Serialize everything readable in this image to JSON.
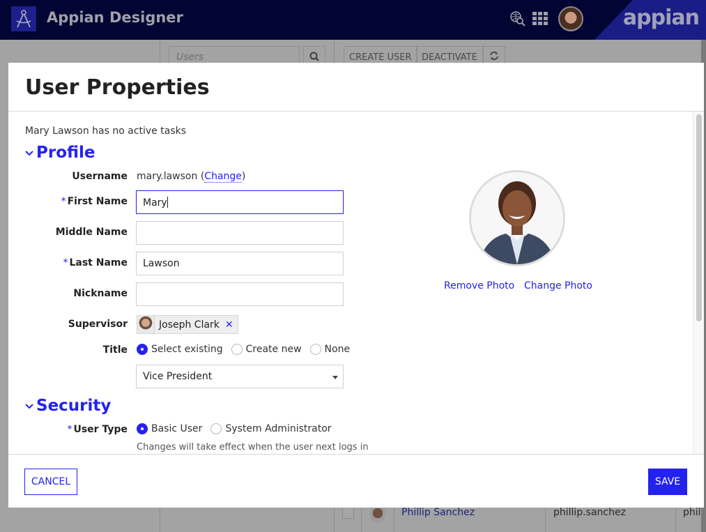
{
  "app": {
    "title": "Appian Designer",
    "brand": "appian"
  },
  "background": {
    "search_placeholder": "Users",
    "create_user_label": "CREATE USER",
    "deactivate_label": "DEACTIVATE",
    "visible_row": {
      "name": "Phillip Sanchez",
      "username": "phillip.sanchez",
      "next_col_partial": "phill"
    }
  },
  "modal": {
    "title": "User Properties",
    "tasks_note": "Mary Lawson has no active tasks",
    "profile": {
      "heading": "Profile",
      "username_label": "Username",
      "username_value": "mary.lawson",
      "username_change_link": "Change",
      "first_name_label": "First Name",
      "first_name_value": "Mary",
      "middle_name_label": "Middle Name",
      "middle_name_value": "",
      "last_name_label": "Last Name",
      "last_name_value": "Lawson",
      "nickname_label": "Nickname",
      "nickname_value": "",
      "supervisor_label": "Supervisor",
      "supervisor_value": "Joseph Clark",
      "title_label": "Title",
      "title_options": [
        "Select existing",
        "Create new",
        "None"
      ],
      "title_selected_option": "Select existing",
      "title_dropdown_value": "Vice President",
      "required_marker": "*",
      "remove_photo": "Remove Photo",
      "change_photo": "Change Photo"
    },
    "security": {
      "heading": "Security",
      "user_type_label": "User Type",
      "user_type_options": [
        "Basic User",
        "System Administrator"
      ],
      "user_type_selected": "Basic User",
      "user_type_hint": "Changes will take effect when the user next logs in"
    },
    "footer": {
      "cancel_label": "CANCEL",
      "save_label": "SAVE"
    }
  },
  "colors": {
    "accent": "#2322f0",
    "topbar": "#020433",
    "overlay_gray": "#a3a3a3"
  }
}
